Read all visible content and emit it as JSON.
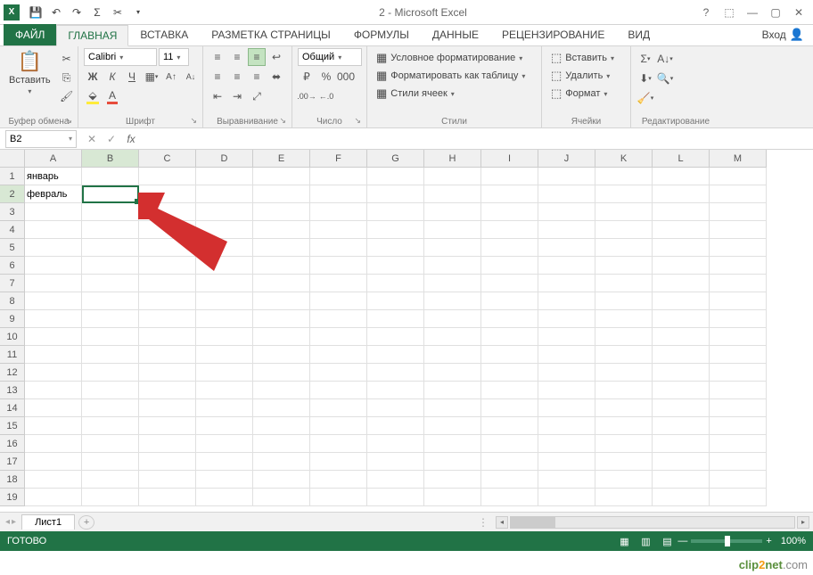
{
  "title": "2 - Microsoft Excel",
  "app_icon_text": "X",
  "tabs": {
    "file": "ФАЙЛ",
    "home": "ГЛАВНАЯ",
    "insert": "ВСТАВКА",
    "page_layout": "РАЗМЕТКА СТРАНИЦЫ",
    "formulas": "ФОРМУЛЫ",
    "data": "ДАННЫЕ",
    "review": "РЕЦЕНЗИРОВАНИЕ",
    "view": "ВИД"
  },
  "signin": "Вход",
  "ribbon": {
    "clipboard": {
      "paste": "Вставить",
      "label": "Буфер обмена"
    },
    "font": {
      "name": "Calibri",
      "size": "11",
      "bold": "Ж",
      "italic": "К",
      "underline": "Ч",
      "label": "Шрифт"
    },
    "align": {
      "label": "Выравнивание"
    },
    "number": {
      "format": "Общий",
      "label": "Число"
    },
    "styles": {
      "cond": "Условное форматирование",
      "table": "Форматировать как таблицу",
      "cell": "Стили ячеек",
      "label": "Стили"
    },
    "cells": {
      "insert": "Вставить",
      "delete": "Удалить",
      "format": "Формат",
      "label": "Ячейки"
    },
    "editing": {
      "label": "Редактирование"
    }
  },
  "namebox": "B2",
  "formula": "",
  "columns": [
    "A",
    "B",
    "C",
    "D",
    "E",
    "F",
    "G",
    "H",
    "I",
    "J",
    "K",
    "L",
    "M"
  ],
  "rows": [
    "1",
    "2",
    "3",
    "4",
    "5",
    "6",
    "7",
    "8",
    "9",
    "10",
    "11",
    "12",
    "13",
    "14",
    "15",
    "16",
    "17",
    "18",
    "19"
  ],
  "cells": {
    "A1": "январь",
    "A2": "февраль"
  },
  "selected": "B2",
  "sheet": "Лист1",
  "status": "ГОТОВО",
  "zoom": "100%",
  "watermark": {
    "brand1": "clip",
    "brand2": "2",
    "brand3": "net",
    "tld": ".com"
  }
}
